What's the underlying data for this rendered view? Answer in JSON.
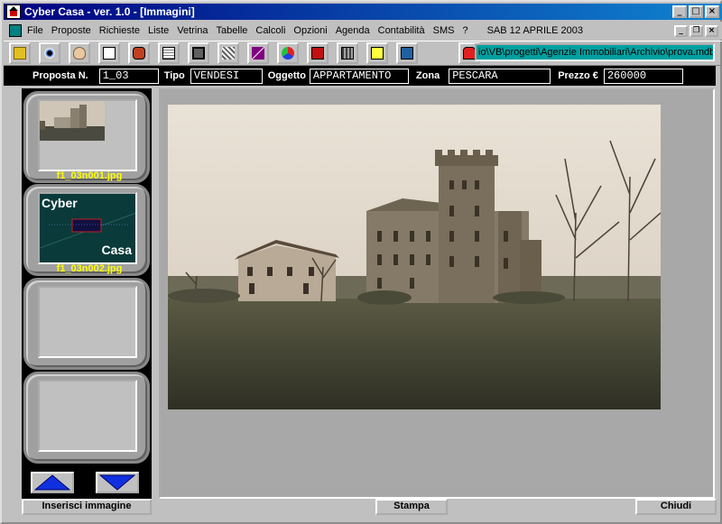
{
  "window": {
    "title": "Cyber Casa - ver. 1.0 - [Immagini]",
    "min": "_",
    "max": "□",
    "close": "×"
  },
  "menu": {
    "items": [
      "File",
      "Proposte",
      "Richieste",
      "Liste",
      "Vetrina",
      "Tabelle",
      "Calcoli",
      "Opzioni",
      "Agenda",
      "Contabilità",
      "SMS",
      "?"
    ],
    "date": "SAB 12 APRILE 2003"
  },
  "toolbar": {
    "icons": [
      "folder-icon",
      "eye-icon",
      "ear-icon",
      "door-icon",
      "phone-icon",
      "notepad-icon",
      "monitor-icon",
      "grid-icon",
      "chart-icon",
      "color-icon",
      "book-icon",
      "calculator-icon",
      "post-icon",
      "building-icon",
      "lock-icon"
    ],
    "path": "io\\VB\\progetti\\Agenzie Immobiliari\\Archivio\\prova.mdb"
  },
  "info": {
    "proposta_label": "Proposta N.",
    "proposta_value": "1_03",
    "tipo_label": "Tipo",
    "tipo_value": "VENDESI",
    "oggetto_label": "Oggetto",
    "oggetto_value": "APPARTAMENTO",
    "zona_label": "Zona",
    "zona_value": "PESCARA",
    "prezzo_label": "Prezzo €",
    "prezzo_value": "260000"
  },
  "thumbnails": [
    {
      "label": "f1_03n001.jpg"
    },
    {
      "label": "f1_03n002.jpg",
      "title_top": "Cyber",
      "title_bottom": "Casa"
    },
    {
      "label": ""
    },
    {
      "label": ""
    }
  ],
  "buttons": {
    "insert": "Inserisci immagine",
    "print": "Stampa",
    "close": "Chiudi"
  },
  "colors": {
    "title_start": "#000080",
    "title_end": "#1084d0",
    "thumb_label": "#ffff00",
    "path_bg": "#00a0a0",
    "cybercasa_bg": "#0a3a3a"
  }
}
